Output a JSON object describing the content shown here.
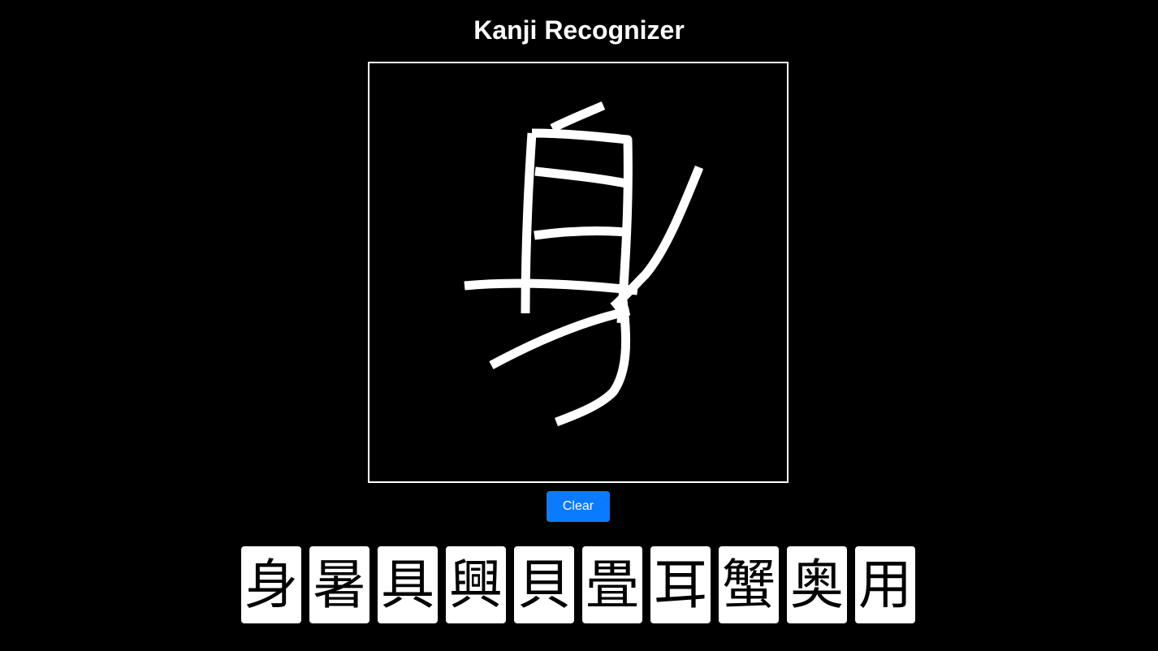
{
  "app": {
    "title": "Kanji Recognizer"
  },
  "canvas": {
    "stroke_color": "#ffffff",
    "background_color": "#000000",
    "border_color": "#ffffff"
  },
  "controls": {
    "clear_label": "Clear",
    "clear_color": "#0a7bff"
  },
  "candidates": [
    "身",
    "暑",
    "具",
    "興",
    "貝",
    "畳",
    "耳",
    "蟹",
    "奥",
    "用"
  ]
}
